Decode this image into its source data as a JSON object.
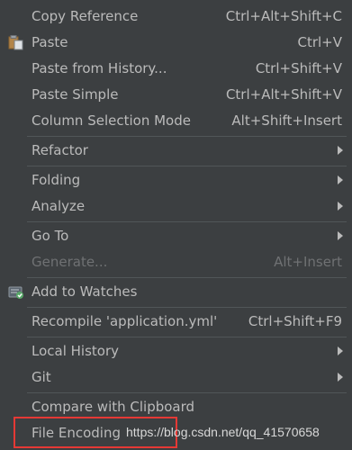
{
  "menu": {
    "items": [
      {
        "label": "Copy Reference",
        "shortcut": "Ctrl+Alt+Shift+C"
      },
      {
        "label": "Paste",
        "shortcut": "Ctrl+V",
        "icon": "clipboard-icon"
      },
      {
        "label": "Paste from History...",
        "shortcut": "Ctrl+Shift+V"
      },
      {
        "label": "Paste Simple",
        "shortcut": "Ctrl+Alt+Shift+V"
      },
      {
        "label": "Column Selection Mode",
        "shortcut": "Alt+Shift+Insert"
      },
      {
        "label": "Refactor",
        "submenu": true
      },
      {
        "label": "Folding",
        "submenu": true
      },
      {
        "label": "Analyze",
        "submenu": true
      },
      {
        "label": "Go To",
        "submenu": true
      },
      {
        "label": "Generate...",
        "shortcut": "Alt+Insert",
        "disabled": true
      },
      {
        "label": "Add to Watches",
        "icon": "add-watch-icon"
      },
      {
        "label": "Recompile 'application.yml'",
        "shortcut": "Ctrl+Shift+F9"
      },
      {
        "label": "Local History",
        "submenu": true
      },
      {
        "label": "Git",
        "submenu": true
      },
      {
        "label": "Compare with Clipboard"
      },
      {
        "label": "File Encoding"
      }
    ]
  },
  "watermark": "https://blog.csdn.net/qq_41570658",
  "colors": {
    "background": "#3c3f41",
    "text": "#bbbbbb",
    "disabled_text": "#6f7173",
    "separator": "#515658",
    "highlight_box": "#e53935"
  }
}
